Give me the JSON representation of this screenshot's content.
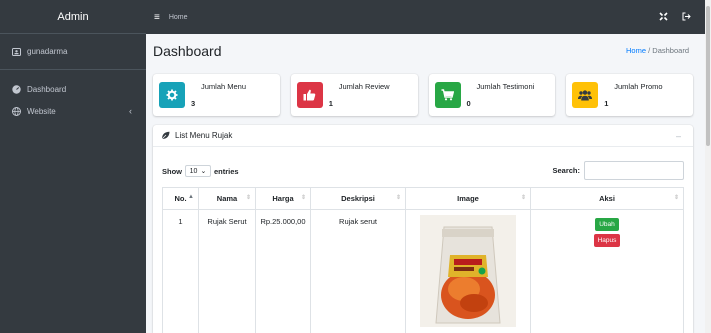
{
  "sidebar": {
    "brand": "Admin",
    "user": "gunadarma",
    "items": [
      {
        "label": "Dashboard",
        "icon": "dashboard-icon"
      },
      {
        "label": "Website",
        "icon": "globe-icon"
      }
    ]
  },
  "topbar": {
    "home_link": "Home"
  },
  "page": {
    "title": "Dashboard",
    "breadcrumb_home": "Home",
    "breadcrumb_separator": "/",
    "breadcrumb_current": "Dashboard"
  },
  "boxes": [
    {
      "label": "Jumlah Menu",
      "value": "3",
      "color": "#17a2b8",
      "icon": "gear-icon"
    },
    {
      "label": "Jumlah Review",
      "value": "1",
      "color": "#dc3545",
      "icon": "thumbs-up-icon"
    },
    {
      "label": "Jumlah Testimoni",
      "value": "0",
      "color": "#28a745",
      "icon": "cart-icon"
    },
    {
      "label": "Jumlah Promo",
      "value": "1",
      "color": "#ffc107",
      "icon": "users-icon"
    }
  ],
  "card": {
    "title": "List Menu Rujak",
    "show_label": "Show",
    "entries_value": "10",
    "entries_label": "entries",
    "search_label": "Search:"
  },
  "table": {
    "headers": [
      "No.",
      "Nama",
      "Harga",
      "Deskripsi",
      "Image",
      "Aksi"
    ],
    "rows": [
      {
        "no": "1",
        "nama": "Rujak Serut",
        "harga": "Rp.25.000,00",
        "deskripsi": "Rujak serut",
        "edit_label": "Ubah",
        "delete_label": "Hapus"
      }
    ]
  }
}
